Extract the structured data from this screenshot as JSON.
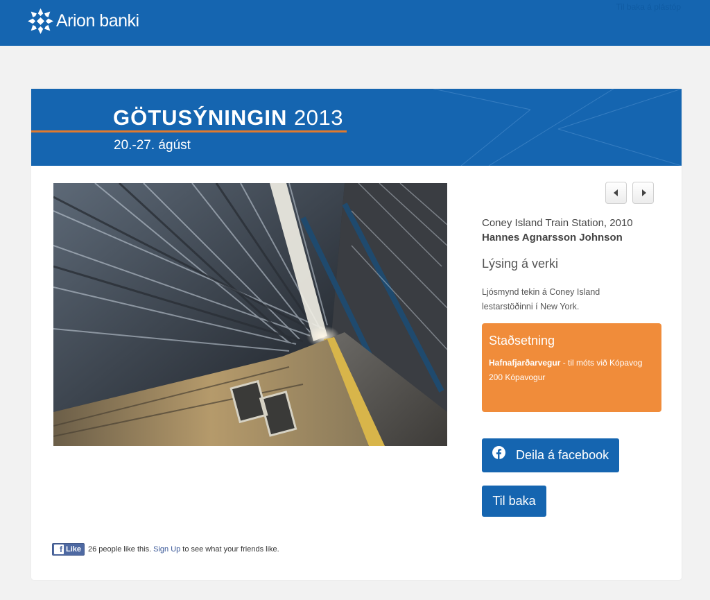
{
  "header": {
    "logo_text": "Arion banki",
    "top_link": "Til baka á plástóp"
  },
  "banner": {
    "title_name": "GÖTUSÝNINGIN",
    "title_year": "2013",
    "dates": "20.-27. ágúst"
  },
  "artwork": {
    "title": "Coney Island Train Station, 2010",
    "artist": "Hannes Agnarsson Johnson",
    "description_heading": "Lýsing á verki",
    "description": "Ljósmynd tekin á Coney Island lestarstöðinni í New York."
  },
  "location": {
    "heading": "Staðsetning",
    "street": "Hafnafjarðarvegur",
    "street_suffix": " - til móts við Kópavog",
    "postal": "200 Kópavogur"
  },
  "buttons": {
    "share_facebook": "Deila á facebook",
    "back": "Til baka"
  },
  "facebook_like": {
    "like_label": "Like",
    "count_text": "26 people like this.",
    "signup_link": "Sign Up",
    "signup_suffix": "to see what your friends like."
  },
  "colors": {
    "brand_blue": "#1565b0",
    "accent_orange": "#f08c3a",
    "rule_orange": "#e07a2e",
    "facebook_blue": "#4e69a2"
  }
}
